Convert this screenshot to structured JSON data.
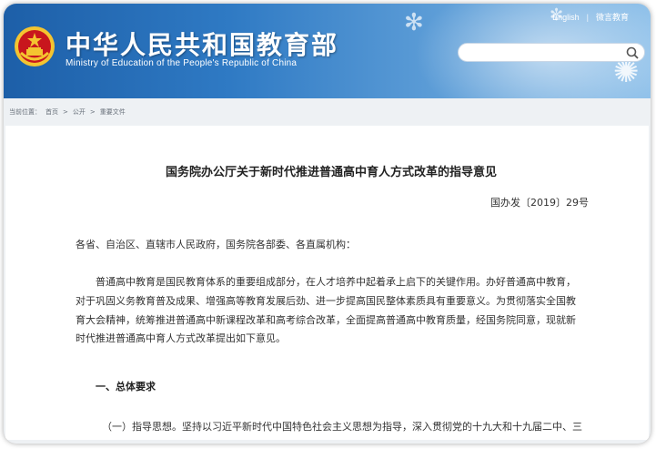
{
  "header": {
    "site_title_cn": "中华人民共和国教育部",
    "site_title_en": "Ministry of Education of the People's Republic of China",
    "links": {
      "english": "English",
      "separator": "|",
      "wechat": "微言教育"
    },
    "search": {
      "placeholder": "",
      "value": ""
    },
    "colors": {
      "banner_start": "#1d5fa8",
      "banner_end": "#8cbfe9",
      "emblem_red": "#c8161d",
      "emblem_gold": "#f4c430"
    },
    "icons": {
      "emblem": "national-emblem-icon",
      "search": "search-icon"
    }
  },
  "breadcrumb": {
    "prefix": "当前位置：",
    "items": [
      "首页",
      "公开",
      "重要文件"
    ],
    "separator": ">"
  },
  "document": {
    "title": "国务院办公厅关于新时代推进普通高中育人方式改革的指导意见",
    "number": "国办发〔2019〕29号",
    "addressee": "各省、自治区、直辖市人民政府，国务院各部委、各直属机构：",
    "intro_lines": [
      "普通高中教育是国民教育体系的重要组成部分，在人才培养中起着承上启下的关键作用。办好普通高中教育，",
      "对于巩固义务教育普及成果、增强高等教育发展后劲、进一步提高国民整体素质具有重要意义。为贯彻落实全国教",
      "育大会精神，统筹推进普通高中新课程改革和高考综合改革，全面提高普通高中教育质量，经国务院同意，现就新",
      "时代推进普通高中育人方式改革提出如下意见。"
    ],
    "section_heading": "一、总体要求",
    "item_1": "（一）指导思想。坚持以习近平新时代中国特色社会主义思想为指导，深入贯彻党的十九大和十九届二中、三"
  }
}
